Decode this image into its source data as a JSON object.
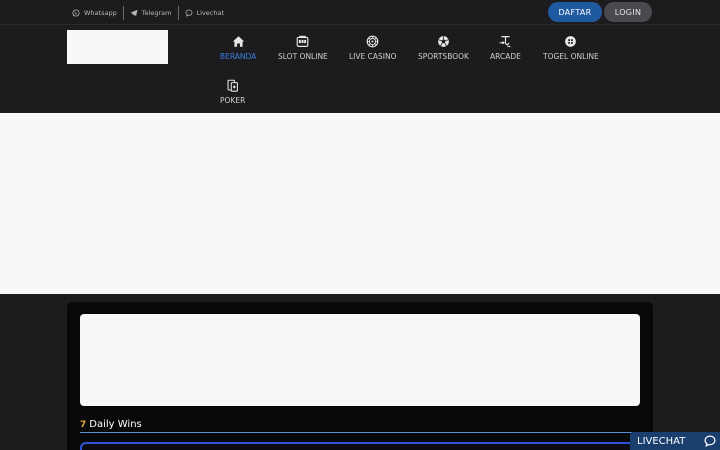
{
  "topbar": {
    "contacts": [
      {
        "label": "Whatsapp",
        "icon": "whatsapp-icon"
      },
      {
        "label": "Telegram",
        "icon": "telegram-icon"
      },
      {
        "label": "Livechat",
        "icon": "chat-icon"
      }
    ],
    "register_label": "DAFTAR",
    "login_label": "LOGIN"
  },
  "nav": {
    "items": [
      {
        "label": "BERANDA",
        "icon": "home-icon",
        "active": true
      },
      {
        "label": "SLOT ONLINE",
        "icon": "slot-machine-icon",
        "active": false
      },
      {
        "label": "LIVE CASINO",
        "icon": "roulette-icon",
        "active": false
      },
      {
        "label": "SPORTSBOOK",
        "icon": "soccer-ball-icon",
        "active": false
      },
      {
        "label": "ARCADE",
        "icon": "fishing-icon",
        "active": false
      },
      {
        "label": "TOGEL ONLINE",
        "icon": "lottery-ball-icon",
        "active": false
      },
      {
        "label": "POKER",
        "icon": "cards-icon",
        "active": false
      }
    ]
  },
  "main": {
    "daily_wins": {
      "emoji": "7",
      "title": "Daily Wins"
    }
  },
  "livechat_widget": {
    "label": "LIVECHAT"
  },
  "colors": {
    "background": "#1c1c1e",
    "accent_blue": "#1f5aa0",
    "active_nav": "#3a7ee0",
    "panel": "#080808",
    "wins_border": "#2e54d9"
  }
}
